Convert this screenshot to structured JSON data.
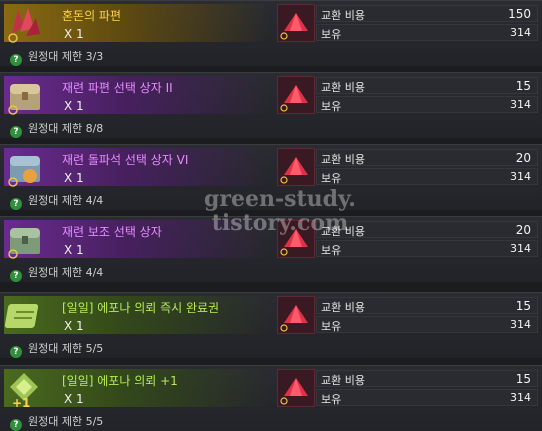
{
  "items": [
    {
      "name": "혼돈의 파편",
      "qty": "X 1",
      "limit": "원정대 제한 3/3",
      "cost_label": "교환 비용",
      "cost": "150",
      "have_label": "보유",
      "have": "314",
      "tone": "gold"
    },
    {
      "name": "재련 파편 선택 상자 II",
      "qty": "X 1",
      "limit": "원정대 제한 8/8",
      "cost_label": "교환 비용",
      "cost": "15",
      "have_label": "보유",
      "have": "314",
      "tone": "purple"
    },
    {
      "name": "재련 돌파석 선택 상자 VI",
      "qty": "X 1",
      "limit": "원정대 제한 4/4",
      "cost_label": "교환 비용",
      "cost": "20",
      "have_label": "보유",
      "have": "314",
      "tone": "purple"
    },
    {
      "name": "재련 보조 선택 상자",
      "qty": "X 1",
      "limit": "원정대 제한 4/4",
      "cost_label": "교환 비용",
      "cost": "20",
      "have_label": "보유",
      "have": "314",
      "tone": "purple"
    },
    {
      "name": "[일일] 에포나 의뢰 즉시 완료권",
      "qty": "X 1",
      "limit": "원정대 제한 5/5",
      "cost_label": "교환 비용",
      "cost": "15",
      "have_label": "보유",
      "have": "314",
      "tone": "green"
    },
    {
      "name": "[일일] 에포나 의뢰 +1",
      "qty": "X 1",
      "limit": "원정대 제한 5/5",
      "cost_label": "교환 비용",
      "cost": "15",
      "have_label": "보유",
      "have": "314",
      "tone": "green"
    }
  ],
  "watermark": [
    "green-study.",
    "tistory.com"
  ],
  "colors": {
    "gold": "#ffd34a",
    "purple": "#e68cff",
    "green": "#b6ec52"
  }
}
